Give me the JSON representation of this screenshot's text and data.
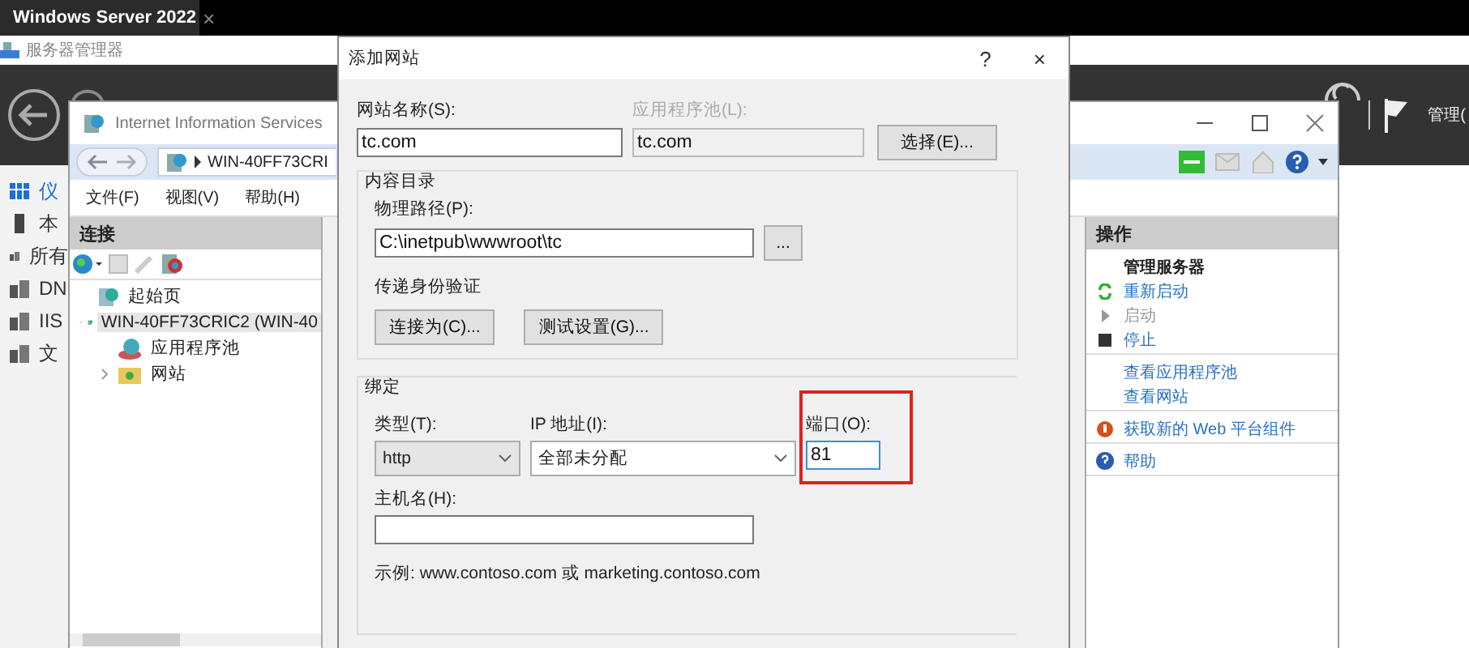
{
  "browser_tab": {
    "title": "Windows Server 2022",
    "close": "×"
  },
  "server_manager": {
    "title": "服务器管理器",
    "menu": "管理(",
    "sidebar": [
      {
        "label": "仪",
        "selected": true
      },
      {
        "label": "本",
        "selected": false
      },
      {
        "label": "所有",
        "selected": false
      },
      {
        "label": "DN",
        "selected": false
      },
      {
        "label": "IIS",
        "selected": false
      },
      {
        "label": "文",
        "selected": false
      }
    ]
  },
  "iis": {
    "title": "Internet Information Services",
    "address": "WIN-40FF73CRI",
    "menu": [
      "文件(F)",
      "视图(V)",
      "帮助(H)"
    ],
    "connections": {
      "title": "连接",
      "tree": [
        {
          "label": "起始页",
          "kind": "page",
          "selected": false
        },
        {
          "label": "WIN-40FF73CRIC2 (WIN-40",
          "kind": "server",
          "selected": true,
          "expanded": true,
          "children": [
            {
              "label": "应用程序池",
              "kind": "pool",
              "selected": false
            },
            {
              "label": "网站",
              "kind": "sites",
              "selected": false,
              "expanded": false
            }
          ]
        }
      ]
    },
    "actions": {
      "title": "操作",
      "groups": [
        {
          "title": "管理服务器",
          "items": [
            {
              "label": "重新启动",
              "disabled": false
            },
            {
              "label": "启动",
              "disabled": true
            },
            {
              "label": "停止",
              "disabled": false
            }
          ]
        },
        {
          "items": [
            {
              "label": "查看应用程序池",
              "disabled": false
            },
            {
              "label": "查看网站",
              "disabled": false
            }
          ]
        },
        {
          "items": [
            {
              "label": "获取新的 Web 平台组件",
              "disabled": false
            }
          ]
        },
        {
          "items": [
            {
              "label": "帮助",
              "disabled": false
            }
          ]
        }
      ]
    }
  },
  "dialog": {
    "title": "添加网站",
    "help": "?",
    "close": "×",
    "site_name": {
      "label": "网站名称(S):",
      "value": "tc.com"
    },
    "app_pool": {
      "label": "应用程序池(L):",
      "value": "tc.com",
      "disabled": true
    },
    "select_button": "选择(E)...",
    "content_dir": {
      "title": "内容目录",
      "path_label": "物理路径(P):",
      "path": "C:\\inetpub\\wwwroot\\tc",
      "browse_button": "...",
      "auth_label": "传递身份验证",
      "connect_button": "连接为(C)...",
      "test_button": "测试设置(G)..."
    },
    "binding": {
      "title": "绑定",
      "type_label": "类型(T):",
      "type": "http",
      "ip_label": "IP 地址(I):",
      "ip": "全部未分配",
      "port_label": "端口(O):",
      "port": "81",
      "port_highlighted": true,
      "host_label": "主机名(H):",
      "example": "示例: www.contoso.com 或 marketing.contoso.com"
    }
  }
}
